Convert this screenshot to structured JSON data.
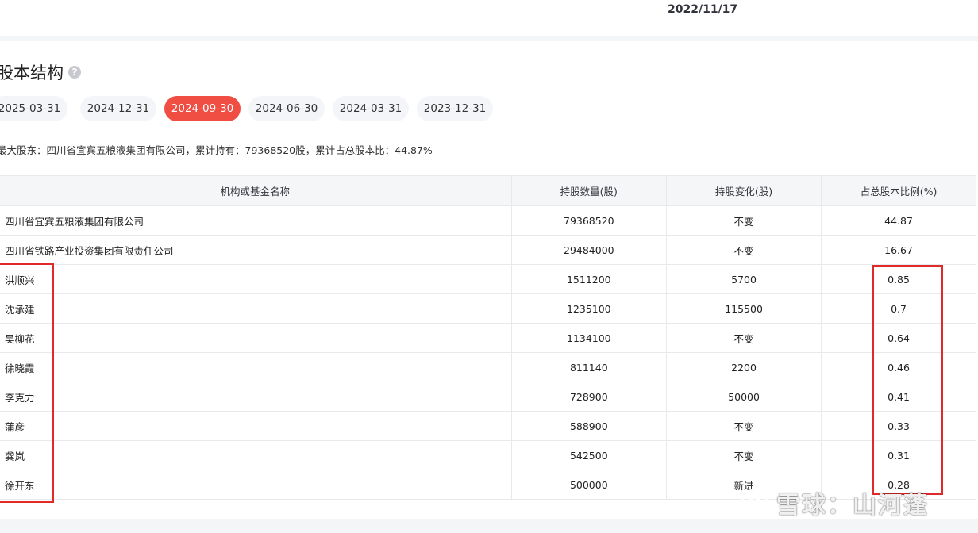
{
  "header": {
    "date": "2022/11/17"
  },
  "section": {
    "title": "股本结构",
    "help_icon": "?"
  },
  "tabs": [
    {
      "label": "2025-03-31",
      "active": false
    },
    {
      "label": "2024-12-31",
      "active": false
    },
    {
      "label": "2024-09-30",
      "active": true
    },
    {
      "label": "2024-06-30",
      "active": false
    },
    {
      "label": "2024-03-31",
      "active": false
    },
    {
      "label": "2023-12-31",
      "active": false
    }
  ],
  "summary": "最大股东：四川省宜宾五粮液集团有限公司，累计持有：79368520股，累计占总股本比：44.87%",
  "table": {
    "headers": [
      "机构或基金名称",
      "持股数量(股)",
      "持股变化(股)",
      "占总股本比例(%)"
    ],
    "rows": [
      {
        "name": "四川省宜宾五粮液集团有限公司",
        "shares": "79368520",
        "change": "不变",
        "ratio": "44.87"
      },
      {
        "name": "四川省铁路产业投资集团有限责任公司",
        "shares": "29484000",
        "change": "不变",
        "ratio": "16.67"
      },
      {
        "name": "洪顺兴",
        "shares": "1511200",
        "change": "5700",
        "ratio": "0.85"
      },
      {
        "name": "沈承建",
        "shares": "1235100",
        "change": "115500",
        "ratio": "0.7"
      },
      {
        "name": "吴柳花",
        "shares": "1134100",
        "change": "不变",
        "ratio": "0.64"
      },
      {
        "name": "徐晓霞",
        "shares": "811140",
        "change": "2200",
        "ratio": "0.46"
      },
      {
        "name": "李克力",
        "shares": "728900",
        "change": "50000",
        "ratio": "0.41"
      },
      {
        "name": "蒲彦",
        "shares": "588900",
        "change": "不变",
        "ratio": "0.33"
      },
      {
        "name": "龚岚",
        "shares": "542500",
        "change": "不变",
        "ratio": "0.31"
      },
      {
        "name": "徐开东",
        "shares": "500000",
        "change": "新进",
        "ratio": "0.28"
      }
    ]
  },
  "watermark": {
    "text": "雪球：山河蓬",
    "logo": "xueqiu-snowball-icon"
  },
  "colors": {
    "active_tab": "#f04e43",
    "highlight_box": "#e02a2a",
    "tab_bg": "#f4f5f8"
  }
}
